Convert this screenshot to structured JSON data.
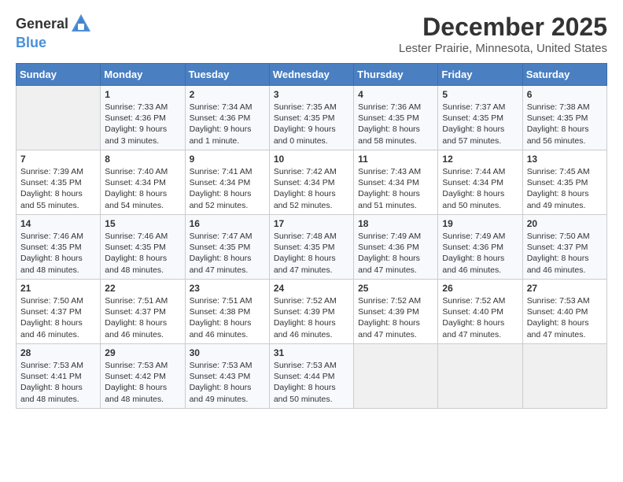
{
  "header": {
    "logo_general": "General",
    "logo_blue": "Blue",
    "title": "December 2025",
    "location": "Lester Prairie, Minnesota, United States"
  },
  "weekdays": [
    "Sunday",
    "Monday",
    "Tuesday",
    "Wednesday",
    "Thursday",
    "Friday",
    "Saturday"
  ],
  "weeks": [
    [
      {
        "day": "",
        "sunrise": "",
        "sunset": "",
        "daylight": ""
      },
      {
        "day": "1",
        "sunrise": "Sunrise: 7:33 AM",
        "sunset": "Sunset: 4:36 PM",
        "daylight": "Daylight: 9 hours and 3 minutes."
      },
      {
        "day": "2",
        "sunrise": "Sunrise: 7:34 AM",
        "sunset": "Sunset: 4:36 PM",
        "daylight": "Daylight: 9 hours and 1 minute."
      },
      {
        "day": "3",
        "sunrise": "Sunrise: 7:35 AM",
        "sunset": "Sunset: 4:35 PM",
        "daylight": "Daylight: 9 hours and 0 minutes."
      },
      {
        "day": "4",
        "sunrise": "Sunrise: 7:36 AM",
        "sunset": "Sunset: 4:35 PM",
        "daylight": "Daylight: 8 hours and 58 minutes."
      },
      {
        "day": "5",
        "sunrise": "Sunrise: 7:37 AM",
        "sunset": "Sunset: 4:35 PM",
        "daylight": "Daylight: 8 hours and 57 minutes."
      },
      {
        "day": "6",
        "sunrise": "Sunrise: 7:38 AM",
        "sunset": "Sunset: 4:35 PM",
        "daylight": "Daylight: 8 hours and 56 minutes."
      }
    ],
    [
      {
        "day": "7",
        "sunrise": "Sunrise: 7:39 AM",
        "sunset": "Sunset: 4:35 PM",
        "daylight": "Daylight: 8 hours and 55 minutes."
      },
      {
        "day": "8",
        "sunrise": "Sunrise: 7:40 AM",
        "sunset": "Sunset: 4:34 PM",
        "daylight": "Daylight: 8 hours and 54 minutes."
      },
      {
        "day": "9",
        "sunrise": "Sunrise: 7:41 AM",
        "sunset": "Sunset: 4:34 PM",
        "daylight": "Daylight: 8 hours and 52 minutes."
      },
      {
        "day": "10",
        "sunrise": "Sunrise: 7:42 AM",
        "sunset": "Sunset: 4:34 PM",
        "daylight": "Daylight: 8 hours and 52 minutes."
      },
      {
        "day": "11",
        "sunrise": "Sunrise: 7:43 AM",
        "sunset": "Sunset: 4:34 PM",
        "daylight": "Daylight: 8 hours and 51 minutes."
      },
      {
        "day": "12",
        "sunrise": "Sunrise: 7:44 AM",
        "sunset": "Sunset: 4:34 PM",
        "daylight": "Daylight: 8 hours and 50 minutes."
      },
      {
        "day": "13",
        "sunrise": "Sunrise: 7:45 AM",
        "sunset": "Sunset: 4:35 PM",
        "daylight": "Daylight: 8 hours and 49 minutes."
      }
    ],
    [
      {
        "day": "14",
        "sunrise": "Sunrise: 7:46 AM",
        "sunset": "Sunset: 4:35 PM",
        "daylight": "Daylight: 8 hours and 48 minutes."
      },
      {
        "day": "15",
        "sunrise": "Sunrise: 7:46 AM",
        "sunset": "Sunset: 4:35 PM",
        "daylight": "Daylight: 8 hours and 48 minutes."
      },
      {
        "day": "16",
        "sunrise": "Sunrise: 7:47 AM",
        "sunset": "Sunset: 4:35 PM",
        "daylight": "Daylight: 8 hours and 47 minutes."
      },
      {
        "day": "17",
        "sunrise": "Sunrise: 7:48 AM",
        "sunset": "Sunset: 4:35 PM",
        "daylight": "Daylight: 8 hours and 47 minutes."
      },
      {
        "day": "18",
        "sunrise": "Sunrise: 7:49 AM",
        "sunset": "Sunset: 4:36 PM",
        "daylight": "Daylight: 8 hours and 47 minutes."
      },
      {
        "day": "19",
        "sunrise": "Sunrise: 7:49 AM",
        "sunset": "Sunset: 4:36 PM",
        "daylight": "Daylight: 8 hours and 46 minutes."
      },
      {
        "day": "20",
        "sunrise": "Sunrise: 7:50 AM",
        "sunset": "Sunset: 4:37 PM",
        "daylight": "Daylight: 8 hours and 46 minutes."
      }
    ],
    [
      {
        "day": "21",
        "sunrise": "Sunrise: 7:50 AM",
        "sunset": "Sunset: 4:37 PM",
        "daylight": "Daylight: 8 hours and 46 minutes."
      },
      {
        "day": "22",
        "sunrise": "Sunrise: 7:51 AM",
        "sunset": "Sunset: 4:37 PM",
        "daylight": "Daylight: 8 hours and 46 minutes."
      },
      {
        "day": "23",
        "sunrise": "Sunrise: 7:51 AM",
        "sunset": "Sunset: 4:38 PM",
        "daylight": "Daylight: 8 hours and 46 minutes."
      },
      {
        "day": "24",
        "sunrise": "Sunrise: 7:52 AM",
        "sunset": "Sunset: 4:39 PM",
        "daylight": "Daylight: 8 hours and 46 minutes."
      },
      {
        "day": "25",
        "sunrise": "Sunrise: 7:52 AM",
        "sunset": "Sunset: 4:39 PM",
        "daylight": "Daylight: 8 hours and 47 minutes."
      },
      {
        "day": "26",
        "sunrise": "Sunrise: 7:52 AM",
        "sunset": "Sunset: 4:40 PM",
        "daylight": "Daylight: 8 hours and 47 minutes."
      },
      {
        "day": "27",
        "sunrise": "Sunrise: 7:53 AM",
        "sunset": "Sunset: 4:40 PM",
        "daylight": "Daylight: 8 hours and 47 minutes."
      }
    ],
    [
      {
        "day": "28",
        "sunrise": "Sunrise: 7:53 AM",
        "sunset": "Sunset: 4:41 PM",
        "daylight": "Daylight: 8 hours and 48 minutes."
      },
      {
        "day": "29",
        "sunrise": "Sunrise: 7:53 AM",
        "sunset": "Sunset: 4:42 PM",
        "daylight": "Daylight: 8 hours and 48 minutes."
      },
      {
        "day": "30",
        "sunrise": "Sunrise: 7:53 AM",
        "sunset": "Sunset: 4:43 PM",
        "daylight": "Daylight: 8 hours and 49 minutes."
      },
      {
        "day": "31",
        "sunrise": "Sunrise: 7:53 AM",
        "sunset": "Sunset: 4:44 PM",
        "daylight": "Daylight: 8 hours and 50 minutes."
      },
      {
        "day": "",
        "sunrise": "",
        "sunset": "",
        "daylight": ""
      },
      {
        "day": "",
        "sunrise": "",
        "sunset": "",
        "daylight": ""
      },
      {
        "day": "",
        "sunrise": "",
        "sunset": "",
        "daylight": ""
      }
    ]
  ]
}
